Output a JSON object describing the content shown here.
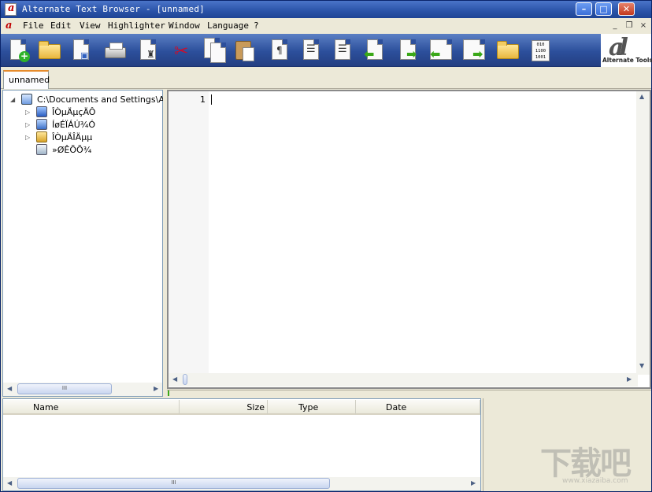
{
  "window": {
    "title": "Alternate Text Browser  - [unnamed]",
    "controls": {
      "minimize": "0",
      "maximize": "1",
      "close": "r"
    }
  },
  "menu": {
    "items": [
      "File",
      "Edit",
      "View",
      "Highlighter",
      "Window",
      "Language",
      "?"
    ],
    "mdi": {
      "minimize": "_",
      "restore": "❐",
      "close": "×"
    }
  },
  "toolbar": {
    "tools": [
      "new-file",
      "open-file",
      "save-file",
      "print",
      "find-binoculars",
      "cut",
      "copy",
      "paste",
      "paragraph",
      "align-left",
      "align-right",
      "back",
      "forward",
      "window-back",
      "window-forward",
      "open-folder",
      "binary-view"
    ],
    "binary_text": "010\n1100\n1001"
  },
  "logo": {
    "text": "Alternate Tools",
    "mark": "al"
  },
  "tabs": [
    {
      "label": "unnamed"
    }
  ],
  "tree": {
    "root": "C:\\Documents and Settings\\Admir",
    "children": [
      {
        "label": "ÎÒµÄµçÄÔ",
        "icon": "computer-icon"
      },
      {
        "label": "ÍøÉÏÁÚ¾Ó",
        "icon": "network-icon"
      },
      {
        "label": "ÎÒµÄÎÄµµ",
        "icon": "documents-icon"
      },
      {
        "label": "»ØÊÕÕ¾",
        "icon": "recycle-bin-icon"
      }
    ],
    "scroll_thumb": "III"
  },
  "editor": {
    "line_numbers": [
      "1"
    ]
  },
  "filelist": {
    "columns": [
      "Name",
      "Size",
      "Type",
      "Date"
    ],
    "scroll_thumb": "III"
  },
  "watermark": {
    "brand": "下载吧",
    "url": "www.xiazaiba.com"
  },
  "colors": {
    "titlebar": "#2a53a8",
    "toolbar": "#2c4f9b",
    "tab_accent": "#e68b2c"
  }
}
